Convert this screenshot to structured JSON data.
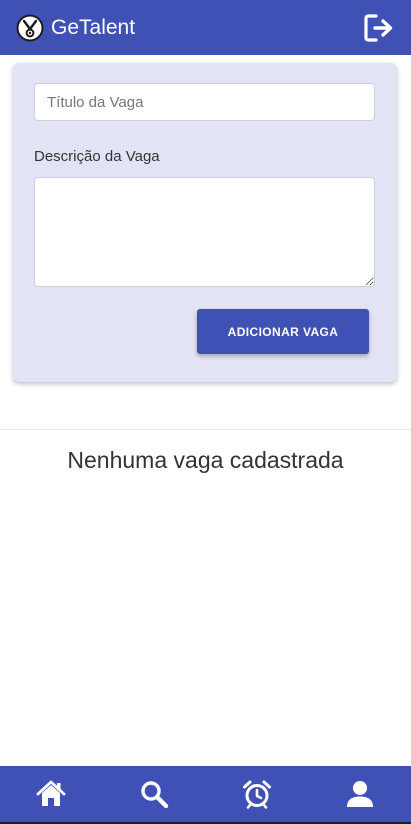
{
  "appbar": {
    "brand": "GeTalent",
    "logo_icon": "getalent-logo",
    "logout_icon": "logout-icon"
  },
  "form": {
    "title_placeholder": "Título da Vaga",
    "description_label": "Descrição da Vaga",
    "add_button_label": "ADICIONAR VAGA"
  },
  "jobs": {
    "empty_message": "Nenhuma vaga cadastrada"
  },
  "bottom_nav": {
    "items": [
      {
        "icon": "home-icon"
      },
      {
        "icon": "search-icon"
      },
      {
        "icon": "alarm-clock-icon"
      },
      {
        "icon": "user-icon"
      }
    ]
  },
  "colors": {
    "primary": "#3f51b5",
    "card_background": "#e3e3f6"
  }
}
